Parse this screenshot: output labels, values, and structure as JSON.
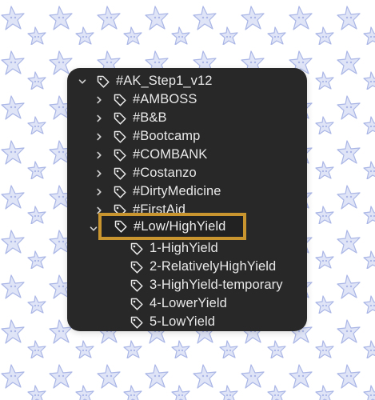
{
  "tree": {
    "root": {
      "label": "#AK_Step1_v12",
      "expanded": true,
      "icon": "tag-icon"
    },
    "children": [
      {
        "label": "#AMBOSS",
        "expanded": false,
        "icon": "tag-icon"
      },
      {
        "label": "#B&B",
        "expanded": false,
        "icon": "tag-icon"
      },
      {
        "label": "#Bootcamp",
        "expanded": false,
        "icon": "tag-icon"
      },
      {
        "label": "#COMBANK",
        "expanded": false,
        "icon": "tag-icon"
      },
      {
        "label": "#Costanzo",
        "expanded": false,
        "icon": "tag-icon"
      },
      {
        "label": "#DirtyMedicine",
        "expanded": false,
        "icon": "tag-icon"
      },
      {
        "label": "#FirstAid",
        "expanded": false,
        "icon": "tag-icon"
      }
    ],
    "selected": {
      "label": "#Low/HighYield",
      "expanded": true,
      "icon": "tag-icon"
    },
    "subchildren": [
      {
        "label": "1-HighYield",
        "icon": "tag-icon"
      },
      {
        "label": "2-RelativelyHighYield",
        "icon": "tag-icon"
      },
      {
        "label": "3-HighYield-temporary",
        "icon": "tag-icon"
      },
      {
        "label": "4-LowerYield",
        "icon": "tag-icon"
      },
      {
        "label": "5-LowYield",
        "icon": "tag-icon"
      }
    ]
  },
  "colors": {
    "panel_bg": "#282828",
    "text": "#e8e8e8",
    "highlight_border": "#c9952f",
    "pattern": "#c5cdf0",
    "page_bg": "#ffffff"
  }
}
